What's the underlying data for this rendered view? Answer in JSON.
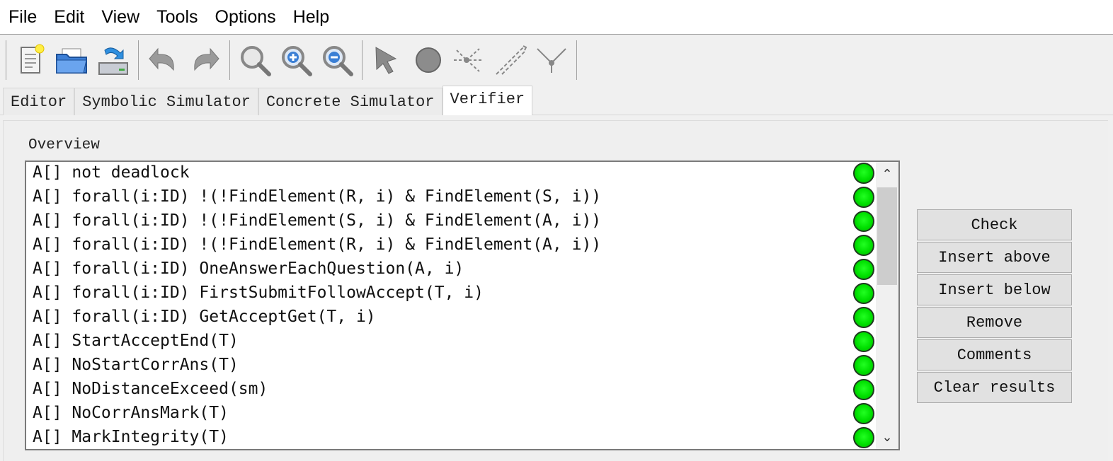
{
  "menu": [
    "File",
    "Edit",
    "View",
    "Tools",
    "Options",
    "Help"
  ],
  "toolbar": {
    "icons": [
      "new-file-icon",
      "open-folder-icon",
      "save-icon",
      "undo-icon",
      "redo-icon",
      "zoom-icon",
      "zoom-in-icon",
      "zoom-out-icon",
      "select-pointer-icon",
      "location-icon",
      "edge-icon",
      "nail-icon",
      "branch-icon"
    ]
  },
  "tabs": [
    {
      "label": "Editor",
      "active": false
    },
    {
      "label": "Symbolic Simulator",
      "active": false
    },
    {
      "label": "Concrete Simulator",
      "active": false
    },
    {
      "label": "Verifier",
      "active": true
    }
  ],
  "verifier": {
    "overview_label": "Overview",
    "queries": [
      "A[] not deadlock",
      "A[] forall(i:ID) !(!FindElement(R, i) & FindElement(S, i))",
      "A[] forall(i:ID) !(!FindElement(S, i) & FindElement(A, i))",
      "A[] forall(i:ID) !(!FindElement(R, i) & FindElement(A, i))",
      "A[] forall(i:ID) OneAnswerEachQuestion(A, i)",
      "A[] forall(i:ID) FirstSubmitFollowAccept(T, i)",
      "A[] forall(i:ID) GetAcceptGet(T, i)",
      "A[] StartAcceptEnd(T)",
      "A[] NoStartCorrAns(T)",
      "A[] NoDistanceExceed(sm)",
      "A[] NoCorrAnsMark(T)",
      "A[] MarkIntegrity(T)"
    ],
    "status_color": "#00e000",
    "buttons": [
      "Check",
      "Insert above",
      "Insert below",
      "Remove",
      "Comments",
      "Clear results"
    ]
  }
}
